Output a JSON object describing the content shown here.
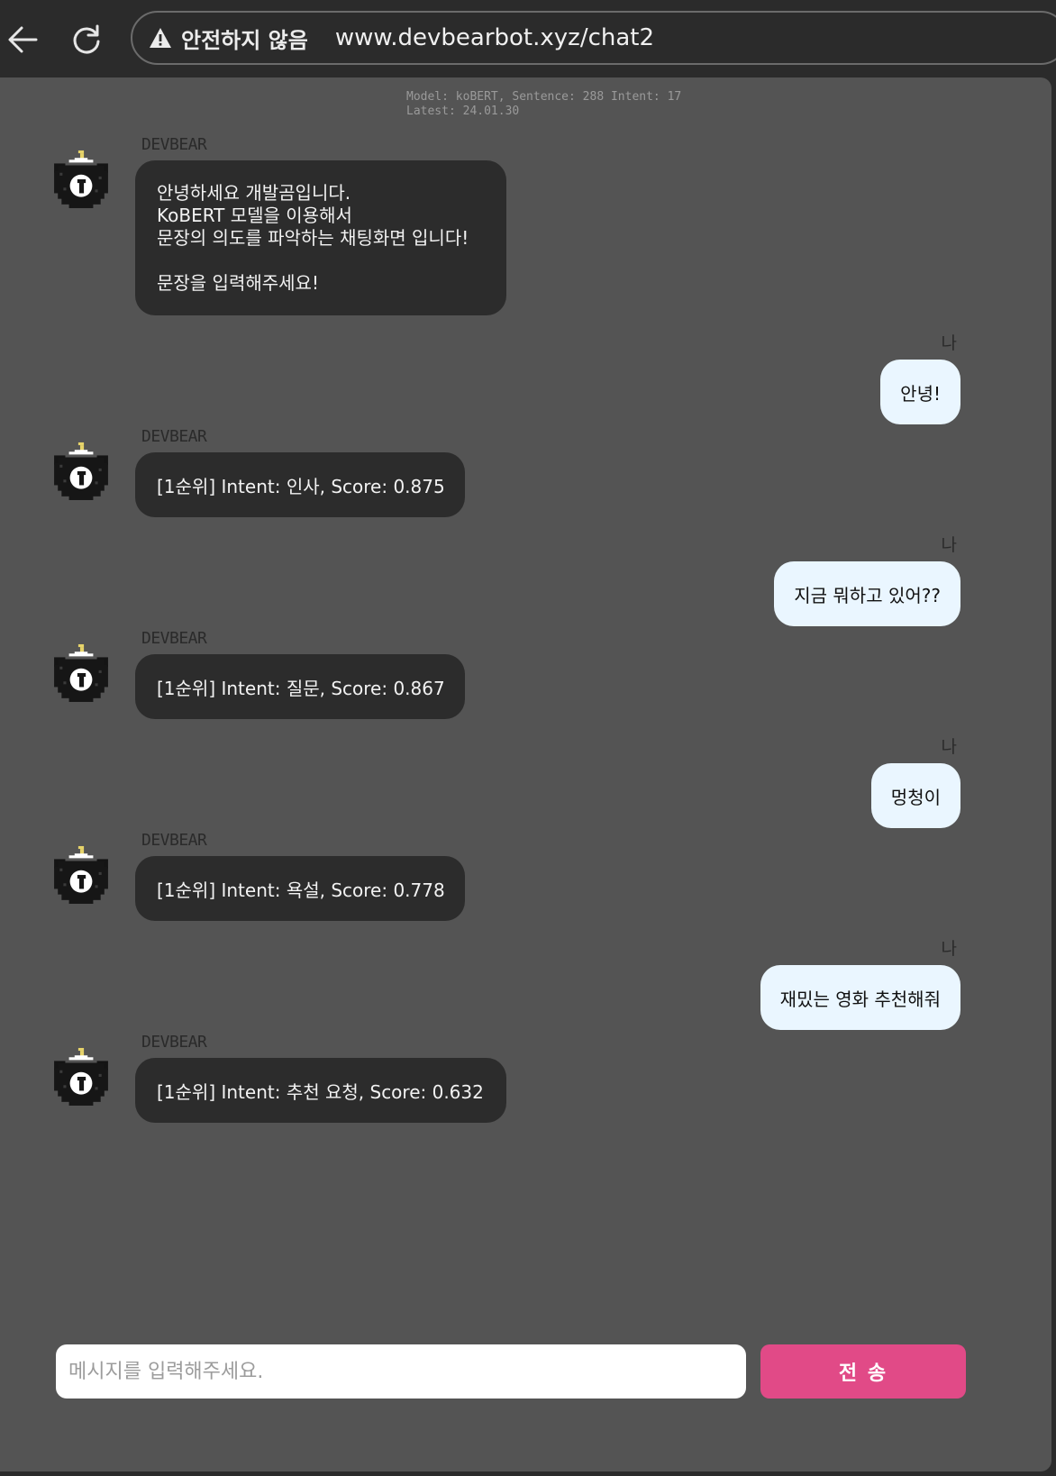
{
  "browser": {
    "security_label": "안전하지 않음",
    "url": "www.devbearbot.xyz/chat2"
  },
  "model_info": {
    "line1": "Model: koBERT, Sentence: 288 Intent: 17",
    "line2": "Latest: 24.01.30"
  },
  "bot": {
    "name": "DEVBEAR"
  },
  "user": {
    "label": "나"
  },
  "messages": [
    {
      "sender": "bot",
      "text": "안녕하세요 개발곰입니다.\nKoBERT 모델을 이용해서\n문장의 의도를 파악하는 채팅화면 입니다!\n\n문장을 입력해주세요!"
    },
    {
      "sender": "user",
      "text": "안녕!"
    },
    {
      "sender": "bot",
      "text": "[1순위] Intent: 인사, Score: 0.875"
    },
    {
      "sender": "user",
      "text": "지금 뭐하고 있어??"
    },
    {
      "sender": "bot",
      "text": "[1순위] Intent: 질문, Score: 0.867"
    },
    {
      "sender": "user",
      "text": "멍청이"
    },
    {
      "sender": "bot",
      "text": "[1순위] Intent: 욕설, Score: 0.778"
    },
    {
      "sender": "user",
      "text": "재밌는 영화 추천해줘"
    },
    {
      "sender": "bot",
      "text": "[1순위] Intent: 추천 요청, Score: 0.632"
    }
  ],
  "input": {
    "placeholder": "메시지를 입력해주세요.",
    "value": ""
  },
  "send_button": {
    "label": "전 송"
  },
  "colors": {
    "panel_bg": "#545454",
    "bot_bubble": "#2c2c2c",
    "user_bubble": "#eaf6ff",
    "send_button": "#e14a87"
  },
  "icons": {
    "back": "arrow-left-icon",
    "reload": "reload-icon",
    "security": "warning-triangle-icon",
    "avatar": "pixel-bear-avatar"
  }
}
